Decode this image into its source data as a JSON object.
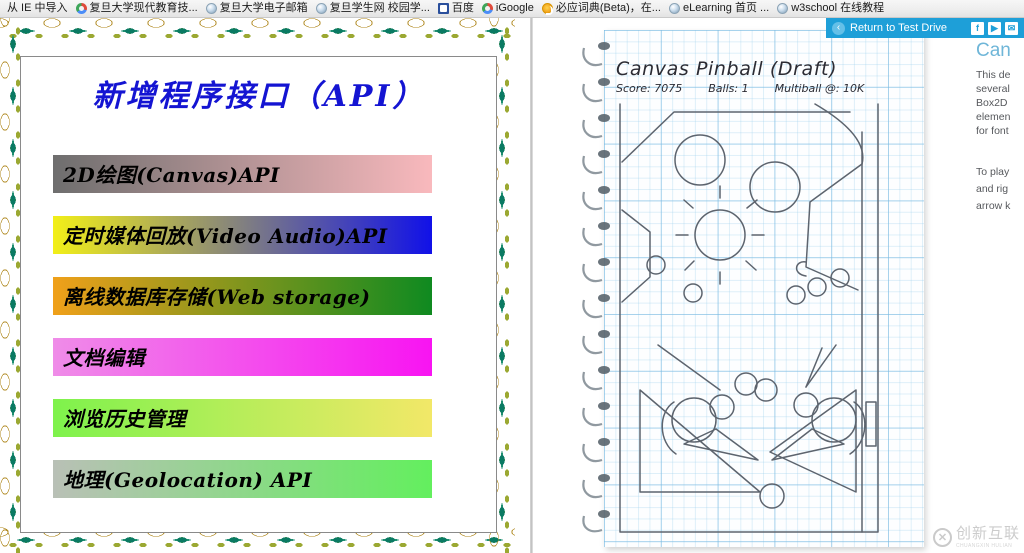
{
  "browser": {
    "bookmarks": [
      {
        "label": "从 IE 中导入",
        "icon": "none"
      },
      {
        "label": "复旦大学现代教育技...",
        "icon": "chrome-icon"
      },
      {
        "label": "复旦大学电子邮箱",
        "icon": "globe-icon"
      },
      {
        "label": "复旦学生网 校园学...",
        "icon": "globe-icon"
      },
      {
        "label": "百度",
        "icon": "baidu-icon"
      },
      {
        "label": "iGoogle",
        "icon": "chrome-icon"
      },
      {
        "label": "必应词典(Beta)，在...",
        "icon": "bing-icon"
      },
      {
        "label": "eLearning 首页 ...",
        "icon": "globe-icon"
      },
      {
        "label": "w3school 在线教程",
        "icon": "globe-icon"
      }
    ]
  },
  "slide": {
    "title": "新增程序接口（API）",
    "bars": [
      {
        "label": "2D绘图(Canvas)API",
        "from": "#6e6e6e",
        "to": "#f9b9bd",
        "width_pct": 92
      },
      {
        "label": "定时媒体回放(Video Audio)API",
        "from": "#f2ef18",
        "to": "#1111e8",
        "width_pct": 92
      },
      {
        "label": "离线数据库存储(Web storage)",
        "from": "#f0a01a",
        "to": "#0f8a20",
        "width_pct": 92
      },
      {
        "label": "文档编辑",
        "from": "#ef8ce8",
        "to": "#f814f2",
        "width_pct": 92
      },
      {
        "label": "浏览历史管理",
        "from": "#7ef24c",
        "to": "#f2e868",
        "width_pct": 92
      },
      {
        "label": "地理(Geolocation) API",
        "from": "#b9c0b6",
        "to": "#63ef5e",
        "width_pct": 92
      }
    ]
  },
  "demo": {
    "header": {
      "back_label": "Return to Test Drive",
      "back_icon": "back-arrow-icon",
      "social": [
        {
          "name": "facebook-icon",
          "glyph": "f"
        },
        {
          "name": "twitter-icon",
          "glyph": "▶"
        },
        {
          "name": "email-icon",
          "glyph": "✉"
        }
      ]
    },
    "notebook": {
      "title": "Canvas Pinball (Draft)",
      "stats": [
        {
          "label": "Score: 7075"
        },
        {
          "label": "Balls: 1"
        },
        {
          "label": "Multiball @: 10K"
        }
      ]
    },
    "sidebar_text": {
      "heading": "Can",
      "paragraph_lines": [
        "This de",
        "several",
        "Box2D",
        "elemen",
        "for font"
      ],
      "paragraph2_lines": [
        "To play",
        "and rig",
        "arrow k"
      ]
    }
  },
  "watermark": {
    "mark": "✕",
    "chinese": "创新互联",
    "english": "CHUANGXIN HULIAN"
  },
  "colors": {
    "accent_blue": "#1e9fd8",
    "title_blue": "#1414d2",
    "grid_blue": "#78b9e1",
    "heading_blue": "#6fb6d8"
  }
}
